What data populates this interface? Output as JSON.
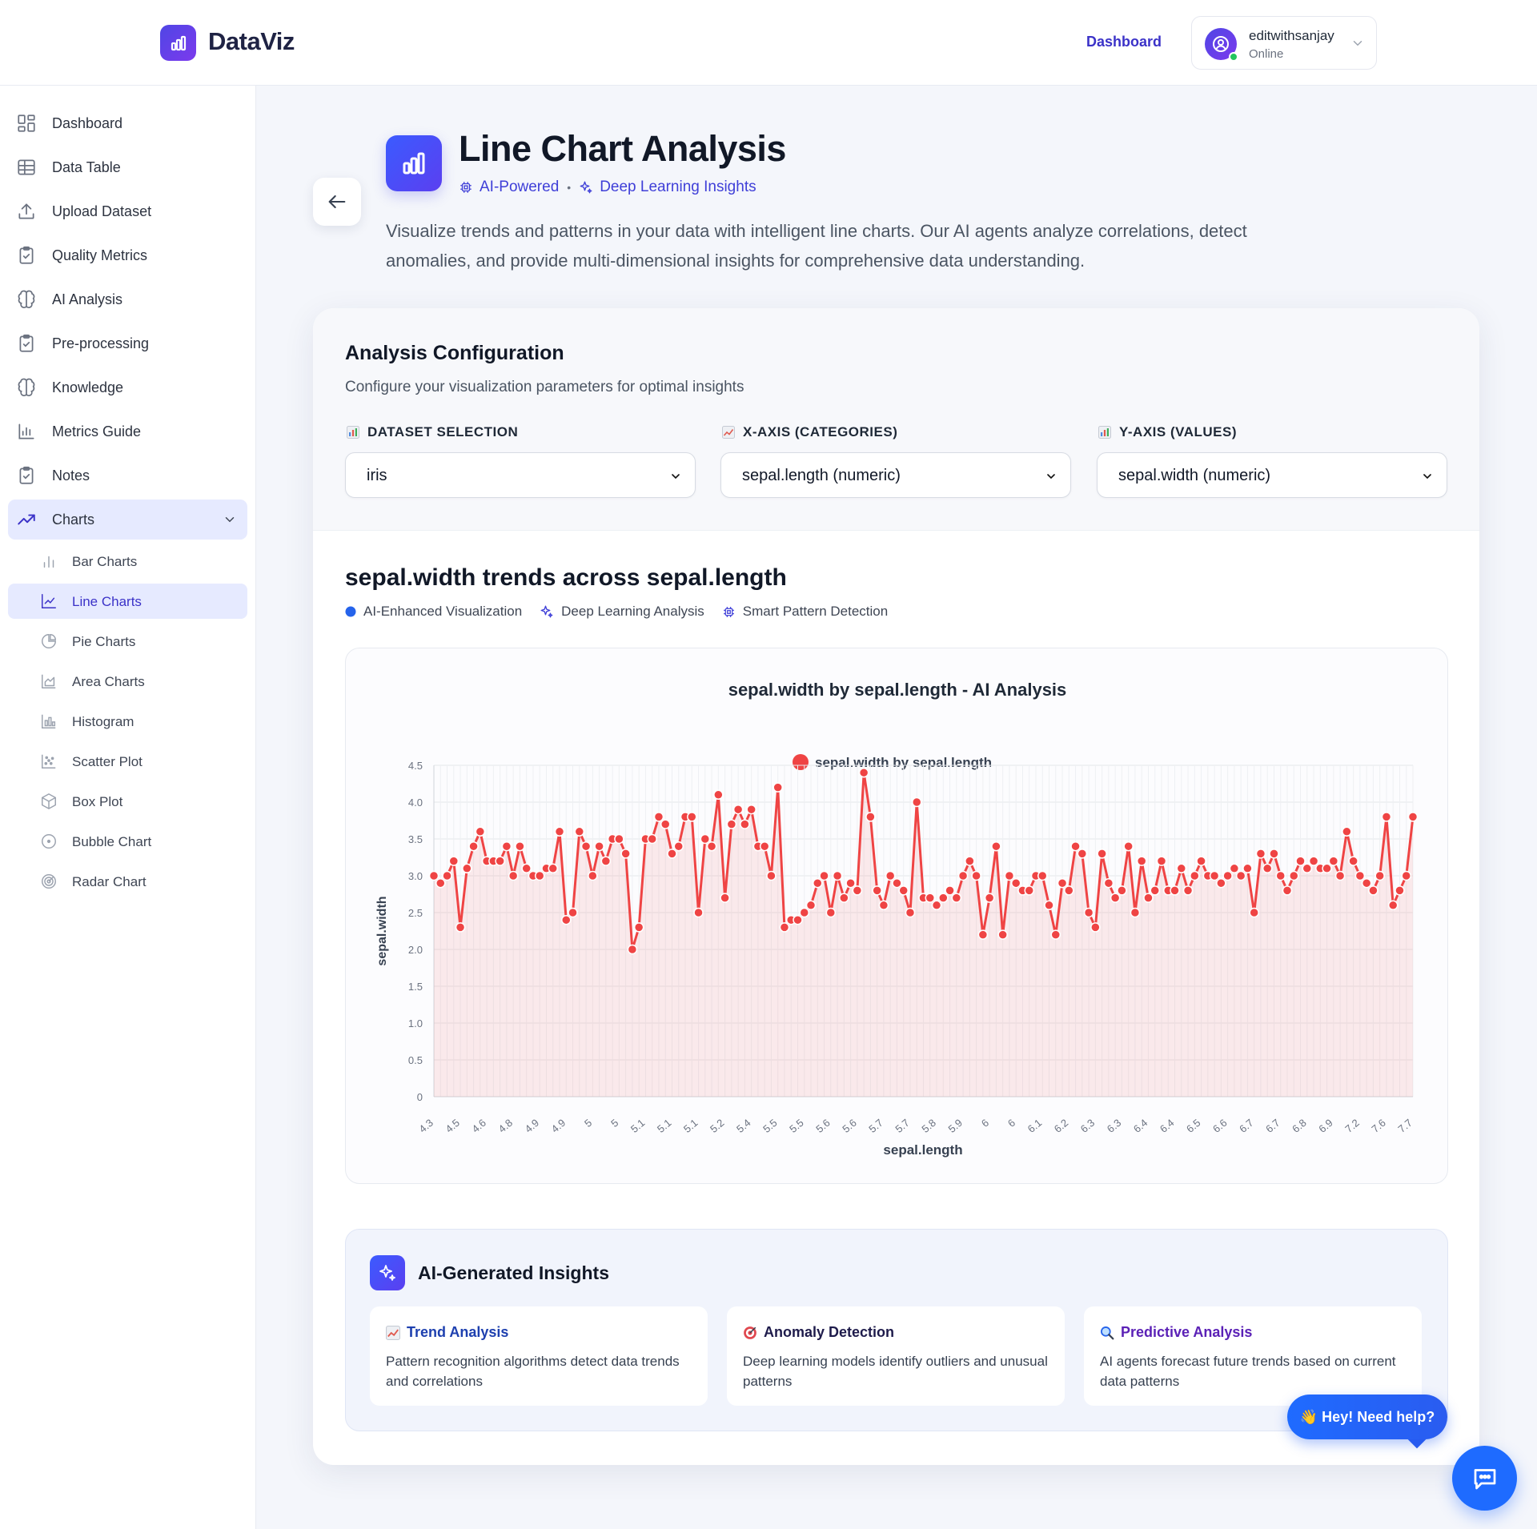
{
  "topbar": {
    "brand": "DataViz",
    "nav_dashboard": "Dashboard",
    "user_name": "editwithsanjay",
    "user_status": "Online"
  },
  "sidebar": {
    "items": [
      {
        "label": "Dashboard",
        "icon": "grid-icon"
      },
      {
        "label": "Data Table",
        "icon": "table-icon"
      },
      {
        "label": "Upload Dataset",
        "icon": "upload-icon"
      },
      {
        "label": "Quality Metrics",
        "icon": "clipboard-icon"
      },
      {
        "label": "AI Analysis",
        "icon": "brain-icon"
      },
      {
        "label": "Pre-processing",
        "icon": "clipboard-icon"
      },
      {
        "label": "Knowledge",
        "icon": "brain-icon"
      },
      {
        "label": "Metrics Guide",
        "icon": "bar-chart-icon"
      },
      {
        "label": "Notes",
        "icon": "clipboard-icon"
      },
      {
        "label": "Charts",
        "icon": "trend-icon"
      }
    ],
    "sub_items": [
      {
        "label": "Bar Charts",
        "icon": "bar-chart-icon"
      },
      {
        "label": "Line Charts",
        "icon": "line-chart-icon"
      },
      {
        "label": "Pie Charts",
        "icon": "pie-chart-icon"
      },
      {
        "label": "Area Charts",
        "icon": "area-chart-icon"
      },
      {
        "label": "Histogram",
        "icon": "histogram-icon"
      },
      {
        "label": "Scatter Plot",
        "icon": "scatter-icon"
      },
      {
        "label": "Box Plot",
        "icon": "box-icon"
      },
      {
        "label": "Bubble Chart",
        "icon": "bubble-icon"
      },
      {
        "label": "Radar Chart",
        "icon": "radar-icon"
      }
    ]
  },
  "header": {
    "title": "Line Chart Analysis",
    "tag1": "AI-Powered",
    "tag2": "Deep Learning Insights",
    "description": "Visualize trends and patterns in your data with intelligent line charts. Our AI agents analyze correlations, detect anomalies, and provide multi-dimensional insights for comprehensive data understanding."
  },
  "config": {
    "title": "Analysis Configuration",
    "subtitle": "Configure your visualization parameters for optimal insights",
    "dataset_label": "DATASET SELECTION",
    "dataset_value": "iris",
    "x_label": "X-AXIS (CATEGORIES)",
    "x_value": "sepal.length (numeric)",
    "y_label": "Y-AXIS (VALUES)",
    "y_value": "sepal.width (numeric)"
  },
  "chart_section": {
    "heading": "sepal.width trends across sepal.length",
    "tag1": "AI-Enhanced Visualization",
    "tag2": "Deep Learning Analysis",
    "tag3": "Smart Pattern Detection"
  },
  "chart_data": {
    "type": "line",
    "title": "sepal.width by sepal.length - AI Analysis",
    "xlabel": "sepal.length",
    "ylabel": "sepal.width",
    "ylim": [
      0,
      4.5
    ],
    "yticks": [
      "0",
      "0.5",
      "1.0",
      "1.5",
      "2.0",
      "2.5",
      "3.0",
      "3.5",
      "4.0",
      "4.5"
    ],
    "x_tick_labels": [
      "4.3",
      "4.5",
      "4.6",
      "4.8",
      "4.9",
      "4.9",
      "5",
      "5",
      "5.1",
      "5.1",
      "5.1",
      "5.2",
      "5.4",
      "5.5",
      "5.5",
      "5.6",
      "5.6",
      "5.7",
      "5.7",
      "5.8",
      "5.9",
      "6",
      "6",
      "6.1",
      "6.2",
      "6.3",
      "6.3",
      "6.4",
      "6.4",
      "6.5",
      "6.6",
      "6.7",
      "6.7",
      "6.8",
      "6.9",
      "7.2",
      "7.6",
      "7.7"
    ],
    "grid": true,
    "legend": "top",
    "fill": true,
    "series": [
      {
        "name": "sepal.width by sepal.length",
        "color": "#ef4444",
        "values": [
          3.0,
          2.9,
          3.0,
          3.2,
          2.3,
          3.1,
          3.4,
          3.6,
          3.2,
          3.2,
          3.2,
          3.4,
          3.0,
          3.4,
          3.1,
          3.0,
          3.0,
          3.1,
          3.1,
          3.6,
          2.4,
          2.5,
          3.6,
          3.4,
          3.0,
          3.4,
          3.2,
          3.5,
          3.5,
          3.3,
          2.0,
          2.3,
          3.5,
          3.5,
          3.8,
          3.7,
          3.3,
          3.4,
          3.8,
          3.8,
          2.5,
          3.5,
          3.4,
          4.1,
          2.7,
          3.7,
          3.9,
          3.7,
          3.9,
          3.4,
          3.4,
          3.0,
          4.2,
          2.3,
          2.4,
          2.4,
          2.5,
          2.6,
          2.9,
          3.0,
          2.5,
          3.0,
          2.7,
          2.9,
          2.8,
          4.4,
          3.8,
          2.8,
          2.6,
          3.0,
          2.9,
          2.8,
          2.5,
          4.0,
          2.7,
          2.7,
          2.6,
          2.7,
          2.8,
          2.7,
          3.0,
          3.2,
          3.0,
          2.2,
          2.7,
          3.4,
          2.2,
          3.0,
          2.9,
          2.8,
          2.8,
          3.0,
          3.0,
          2.6,
          2.2,
          2.9,
          2.8,
          3.4,
          3.3,
          2.5,
          2.3,
          3.3,
          2.9,
          2.7,
          2.8,
          3.4,
          2.5,
          3.2,
          2.7,
          2.8,
          3.2,
          2.8,
          2.8,
          3.1,
          2.8,
          3.0,
          3.2,
          3.0,
          3.0,
          2.9,
          3.0,
          3.1,
          3.0,
          3.1,
          2.5,
          3.3,
          3.1,
          3.3,
          3.0,
          2.8,
          3.0,
          3.2,
          3.1,
          3.2,
          3.1,
          3.1,
          3.2,
          3.0,
          3.6,
          3.2,
          3.0,
          2.9,
          2.8,
          3.0,
          3.8,
          2.6,
          2.8,
          3.0,
          3.8
        ]
      }
    ]
  },
  "insights": {
    "title": "AI-Generated Insights",
    "cards": [
      {
        "title": "Trend Analysis",
        "desc": "Pattern recognition algorithms detect data trends and correlations",
        "color": "#1e40af"
      },
      {
        "title": "Anomaly Detection",
        "desc": "Deep learning models identify outliers and unusual patterns",
        "color": "#1e1b4b"
      },
      {
        "title": "Predictive Analysis",
        "desc": "AI agents forecast future trends based on current data patterns",
        "color": "#5b21b6"
      }
    ]
  },
  "help": {
    "bubble": "👋 Hey! Need help?"
  }
}
